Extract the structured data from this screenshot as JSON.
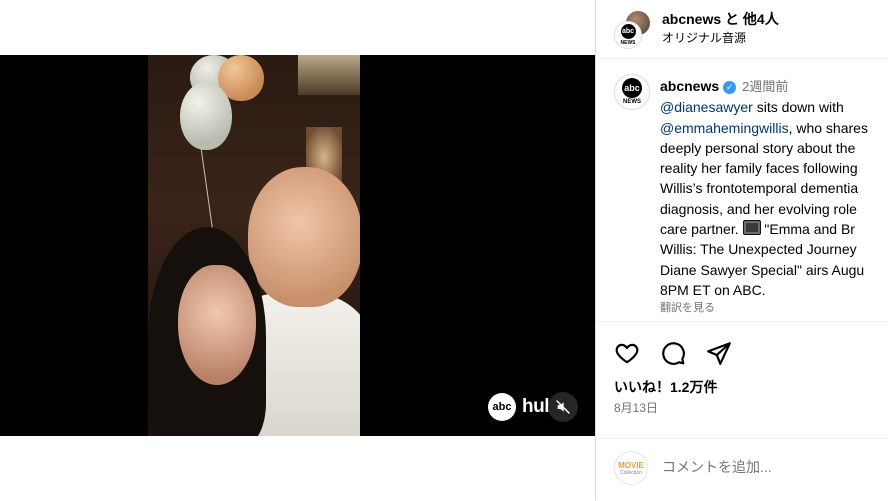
{
  "header": {
    "account": "abcnews",
    "with_others": " と 他4人",
    "audio": "オリジナル音源"
  },
  "video": {
    "watermark_abc": "abc",
    "watermark_hulu": "hulu"
  },
  "caption": {
    "avatar_logo": "abc",
    "avatar_sub": "NEWS",
    "username": "abcnews",
    "time": "2週間前",
    "mention1": "@dianesawyer",
    "text1": " sits down with",
    "mention2": "@emmahemingwillis",
    "text2": ", who shares",
    "line3": "deeply personal story about the",
    "line4": "reality her family faces following",
    "line5": "Willis’s frontotemporal dementia",
    "line6": "diagnosis, and her evolving role",
    "line7_pre": "care partner. ",
    "line7_post": " \"Emma and Br",
    "line8": "Willis: The Unexpected Journey",
    "line9": "Diane Sawyer Special\" airs Augu",
    "line10": "8PM ET on ABC.",
    "translate": "翻訳を見る"
  },
  "actions": {
    "likes": "いいね！1.2万件",
    "date": "8月13日"
  },
  "comment": {
    "avatar_title": "MOVIE",
    "avatar_sub": "Collection",
    "placeholder": "コメントを追加..."
  }
}
